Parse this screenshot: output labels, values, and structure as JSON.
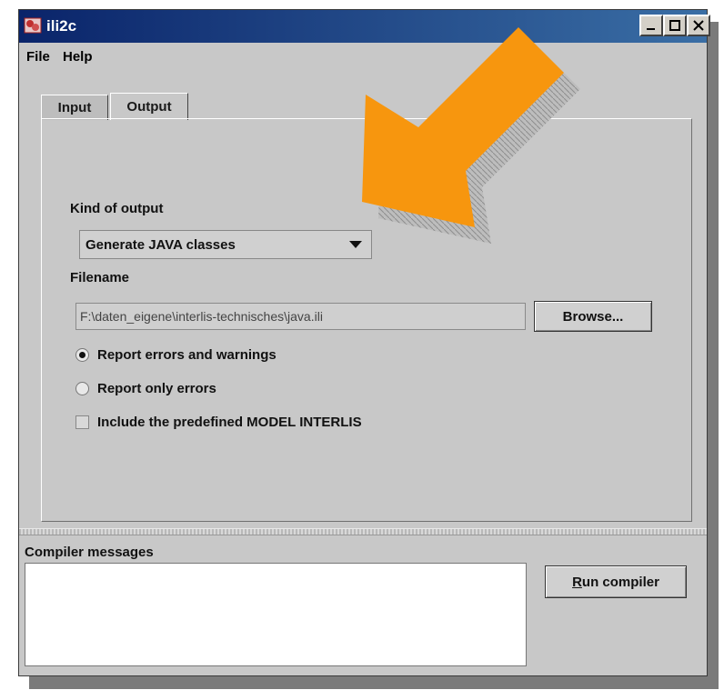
{
  "window": {
    "title": "ili2c"
  },
  "menu": {
    "file": "File",
    "help": "Help"
  },
  "tabs": [
    {
      "label": "Input"
    },
    {
      "label": "Output"
    }
  ],
  "output": {
    "kind_label": "Kind of output",
    "kind_value": "Generate JAVA classes",
    "filename_label": "Filename",
    "filename_value": "F:\\daten_eigene\\interlis-technisches\\java.ili",
    "browse_label": "Browse...",
    "options": [
      {
        "label": "Report errors and warnings",
        "checked": true
      },
      {
        "label": "Report only errors",
        "checked": false
      }
    ],
    "include_label": "Include the predefined MODEL INTERLIS",
    "include_checked": false
  },
  "compiler": {
    "messages_label": "Compiler messages",
    "run_label": "Run compiler"
  },
  "colors": {
    "titlebar": "#0a246a",
    "arrow": "#f7960e",
    "window_bg": "#c8c8c8"
  }
}
